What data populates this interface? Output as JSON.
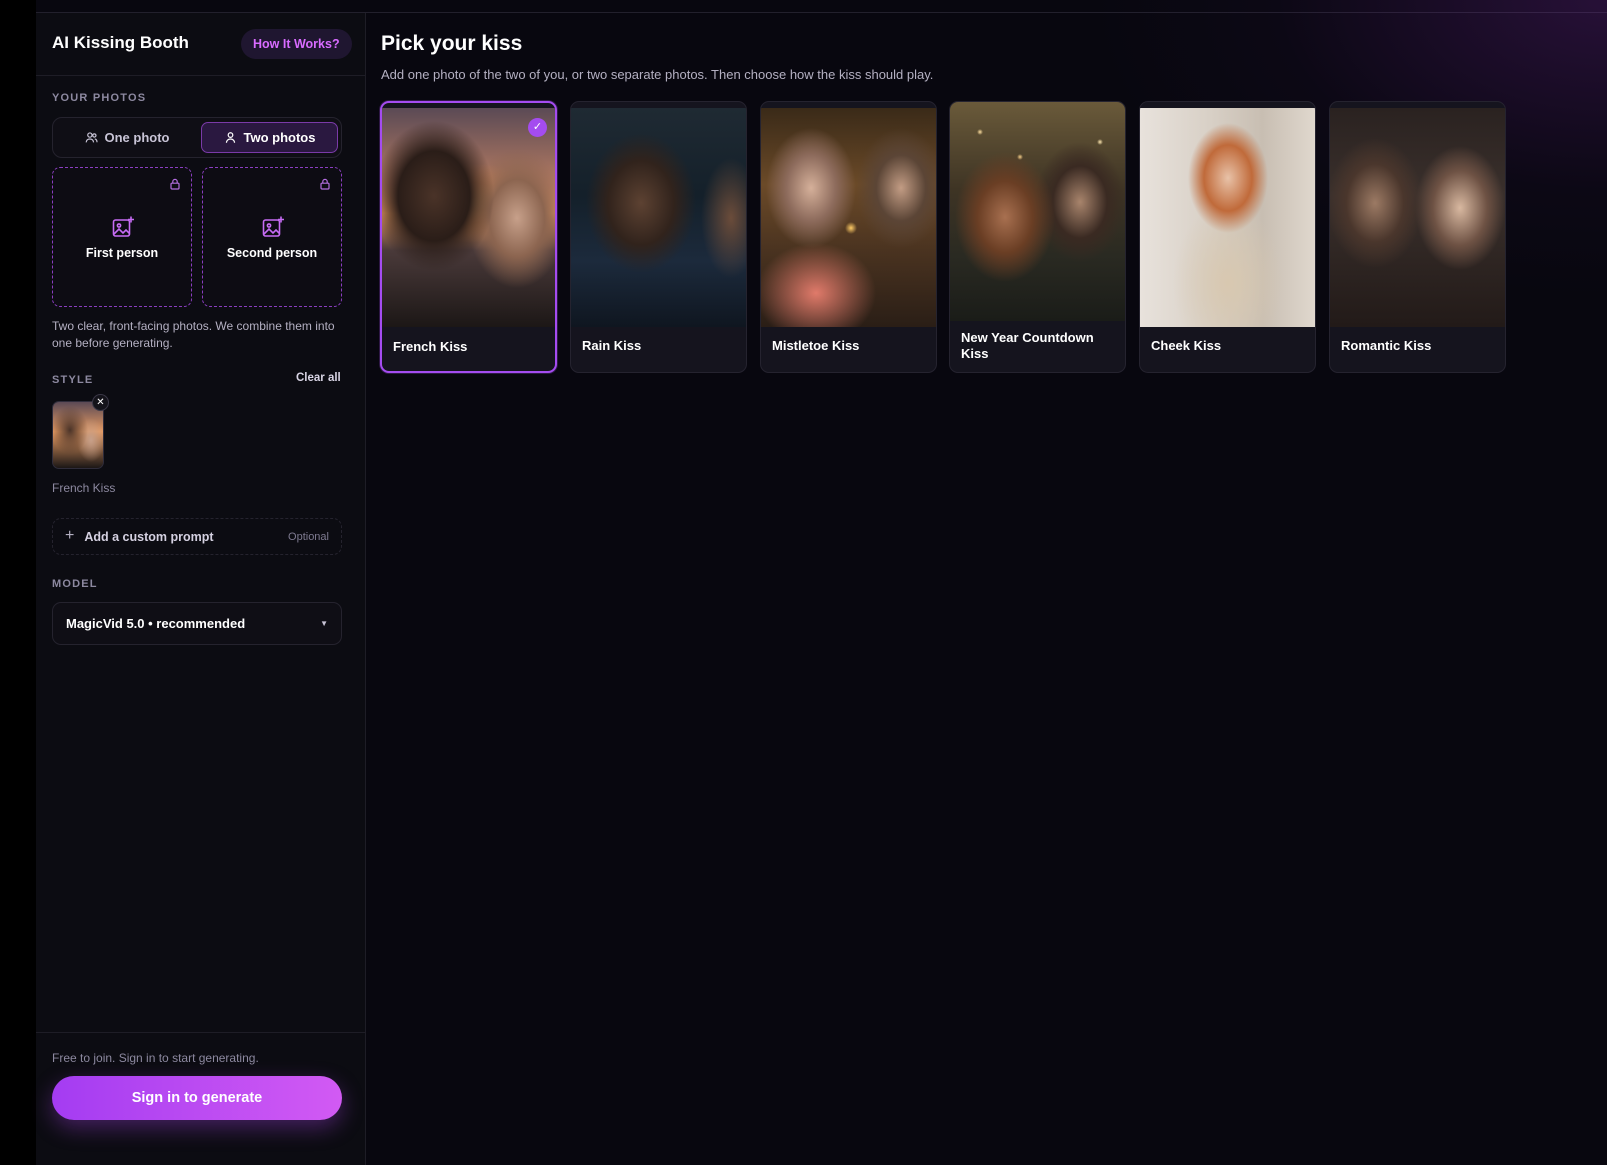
{
  "sidebar": {
    "title": "AI Kissing Booth",
    "how_it_works": "How It Works?",
    "photos_label": "YOUR PHOTOS",
    "toggle": {
      "one": "One photo",
      "two": "Two photos",
      "selected": "two"
    },
    "slots": {
      "first": "First person",
      "second": "Second person"
    },
    "hint": "Two clear, front-facing photos. We combine them into one before generating.",
    "style_label": "STYLE",
    "clear_all": "Clear all",
    "selected_style": "French Kiss",
    "custom_prompt": "Add a custom prompt",
    "custom_prompt_optional": "Optional",
    "model_label": "MODEL",
    "model_value": "MagicVid 5.0 • recommended",
    "footer_note": "Free to join. Sign in to start generating.",
    "signin": "Sign in to generate"
  },
  "main": {
    "title": "Pick your kiss",
    "subtitle": "Add one photo of the two of you, or two separate photos. Then choose how the kiss should play.",
    "cards": [
      {
        "label": "French Kiss",
        "selected": true
      },
      {
        "label": "Rain Kiss",
        "selected": false
      },
      {
        "label": "Mistletoe Kiss",
        "selected": false
      },
      {
        "label": "New Year Countdown Kiss",
        "selected": false
      },
      {
        "label": "Cheek Kiss",
        "selected": false
      },
      {
        "label": "Romantic Kiss",
        "selected": false
      }
    ]
  },
  "colors": {
    "accent": "#a44cf0",
    "background": "#08070f",
    "sidebar": "#0c0c12"
  }
}
